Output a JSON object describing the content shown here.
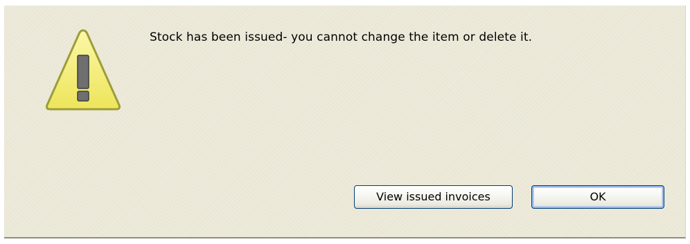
{
  "dialog": {
    "message": "Stock has been issued- you cannot change the item or delete it.",
    "icon": "warning-icon",
    "buttons": {
      "view_invoices_label": "View issued invoices",
      "ok_label": "OK"
    }
  },
  "colors": {
    "dialog_background": "#ece9d8",
    "icon_fill": "#f5f074",
    "icon_outline": "#9c9c3a",
    "button_border": "#003c74",
    "default_button_focus": "#9ab8e8"
  }
}
